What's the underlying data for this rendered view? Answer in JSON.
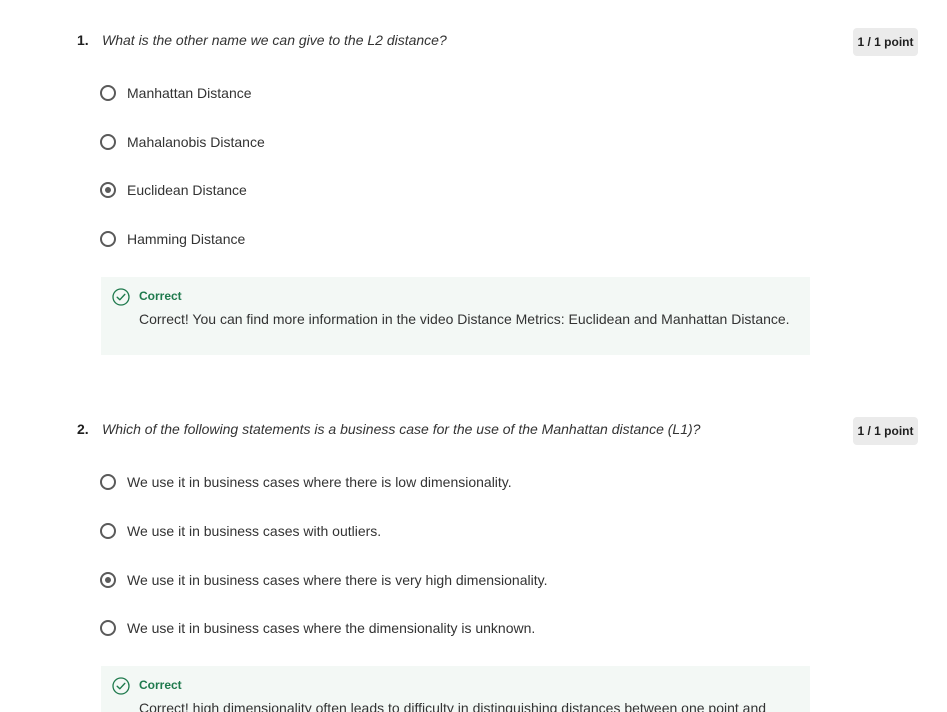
{
  "questions": [
    {
      "number": "1.",
      "text": "What is the other name we can give to the L2 distance?",
      "points": "1 / 1 point",
      "options": [
        {
          "label": "Manhattan Distance",
          "selected": false
        },
        {
          "label": "Mahalanobis Distance",
          "selected": false
        },
        {
          "label": "Euclidean Distance",
          "selected": true
        },
        {
          "label": "Hamming Distance",
          "selected": false
        }
      ],
      "feedback": {
        "icon": "check-circle-icon",
        "title": "Correct",
        "text": "Correct! You can find more information in the video Distance Metrics: Euclidean and Manhattan Distance."
      }
    },
    {
      "number": "2.",
      "text": "Which of the following statements is a business case for the use of the Manhattan distance (L1)?",
      "points": "1 / 1 point",
      "options": [
        {
          "label": "We use it in business cases where there is low dimensionality.",
          "selected": false
        },
        {
          "label": "We use it in business cases with outliers.",
          "selected": false
        },
        {
          "label": "We use it in business cases where there is very high dimensionality.",
          "selected": true
        },
        {
          "label": "We use it in business cases where the dimensionality is unknown.",
          "selected": false
        }
      ],
      "feedback": {
        "icon": "check-circle-icon",
        "title": "Correct",
        "text": "Correct! high dimensionality often leads to difficulty in distinguishing distances between one point and"
      }
    }
  ],
  "colors": {
    "correct_green": "#1f7a4d",
    "feedback_bg": "#f3f8f5",
    "badge_bg": "#ebebeb",
    "radio": "#5a5a5a"
  }
}
